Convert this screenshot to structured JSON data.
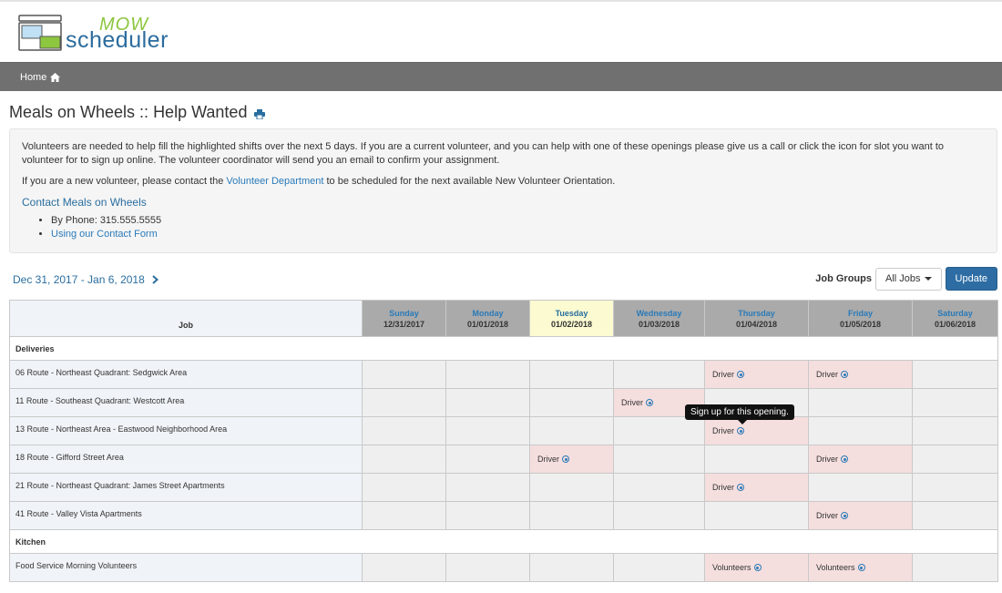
{
  "app": {
    "logo_mow": "MOW",
    "logo_name": "scheduler"
  },
  "nav": {
    "home_label": "Home"
  },
  "page": {
    "title": "Meals on Wheels :: Help Wanted"
  },
  "info": {
    "paragraph1": "Volunteers are needed to help fill the highlighted shifts over the next 5 days. If you are a current volunteer, and you can help with one of these openings please give us a call or click the icon for slot you want to volunteer for to sign up online. The volunteer coordinator will send you an email to confirm your assignment.",
    "paragraph2_before": "If you are a new volunteer, please contact the ",
    "paragraph2_link": "Volunteer Department",
    "paragraph2_after": " to be scheduled for the next available New Volunteer Orientation.",
    "contact_heading": "Contact Meals on Wheels",
    "contact_phone": "By Phone: 315.555.5555",
    "contact_form": "Using our Contact Form"
  },
  "schedule": {
    "date_range": "Dec 31, 2017 - Jan 6, 2018",
    "job_groups_label": "Job Groups",
    "job_groups_selected": "All Jobs",
    "update_label": "Update",
    "job_column": "Job",
    "days": [
      {
        "name": "Sunday",
        "date": "12/31/2017"
      },
      {
        "name": "Monday",
        "date": "01/01/2018"
      },
      {
        "name": "Tuesday",
        "date": "01/02/2018"
      },
      {
        "name": "Wednesday",
        "date": "01/03/2018"
      },
      {
        "name": "Thursday",
        "date": "01/04/2018"
      },
      {
        "name": "Friday",
        "date": "01/05/2018"
      },
      {
        "name": "Saturday",
        "date": "01/06/2018"
      }
    ],
    "groups": [
      {
        "name": "Deliveries",
        "rows": [
          {
            "job": "06 Route - Northeast Quadrant: Sedgwick Area",
            "slots": [
              "",
              "",
              "",
              "",
              "Driver",
              "Driver",
              ""
            ]
          },
          {
            "job": "11 Route - Southeast Quadrant: Westcott Area",
            "slots": [
              "",
              "",
              "",
              "Driver",
              "",
              "",
              ""
            ]
          },
          {
            "job": "13 Route - Northeast Area - Eastwood Neighborhood Area",
            "slots": [
              "",
              "",
              "",
              "",
              "Driver",
              "",
              ""
            ]
          },
          {
            "job": "18 Route - Gifford Street Area",
            "slots": [
              "",
              "",
              "Driver",
              "",
              "",
              "Driver",
              ""
            ]
          },
          {
            "job": "21 Route - Northeast Quadrant: James Street Apartments",
            "slots": [
              "",
              "",
              "",
              "",
              "Driver",
              "",
              ""
            ]
          },
          {
            "job": "41 Route - Valley Vista Apartments",
            "slots": [
              "",
              "",
              "",
              "",
              "",
              "Driver",
              ""
            ]
          }
        ]
      },
      {
        "name": "Kitchen",
        "rows": [
          {
            "job": "Food Service Morning Volunteers",
            "slots": [
              "",
              "",
              "",
              "",
              "Volunteers",
              "Volunteers",
              ""
            ]
          }
        ]
      }
    ],
    "tooltip": "Sign up for this opening."
  },
  "colors": {
    "navbar": "#707070",
    "link": "#2a7ab8",
    "open_slot": "#f5dede",
    "today_header": "#fbfad0",
    "update_button": "#2e6da4"
  }
}
